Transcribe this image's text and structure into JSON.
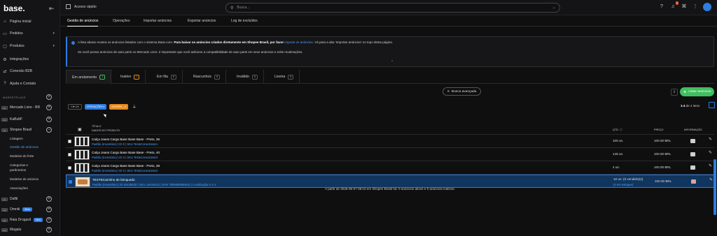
{
  "app": {
    "logo": "base."
  },
  "sidebar": {
    "items": [
      {
        "label": "Página inicial",
        "icon": "home-icon"
      },
      {
        "label": "Pedidos",
        "icon": "cart-icon"
      },
      {
        "label": "Produtos",
        "icon": "box-icon"
      },
      {
        "label": "Integrações",
        "icon": "plug-icon"
      },
      {
        "label": "Conexão B2B",
        "icon": "handshake-icon"
      },
      {
        "label": "Ajuda e Contato",
        "icon": "help-icon"
      }
    ],
    "section_label": "MARKETPLACE",
    "marketplaces": [
      {
        "label": "Mercado Livre - BR"
      },
      {
        "label": "KaBuM!"
      },
      {
        "label": "Shopee Brasil"
      }
    ],
    "shopee_sub": [
      {
        "label": "Listagem"
      },
      {
        "label": "Gestão de anúncios"
      },
      {
        "label": "Modelos de frete"
      },
      {
        "label": "Categorias e"
      },
      {
        "label": "parâmetros"
      },
      {
        "label": "Modelos de anúncio"
      },
      {
        "label": "Associações"
      }
    ],
    "more_marketplaces": [
      {
        "label": "Dafiti"
      },
      {
        "label": "Omnik",
        "tag": "Beta"
      },
      {
        "label": "Raia Drogasil",
        "tag": "New"
      },
      {
        "label": "Magalu"
      }
    ]
  },
  "topbar": {
    "quick_access": "Acesso rápido",
    "search_placeholder": "Busca...",
    "notification_count": "1"
  },
  "main_tabs": [
    {
      "label": "Gestão de anúncios"
    },
    {
      "label": "Operações"
    },
    {
      "label": "Importar anúncios"
    },
    {
      "label": "Exportar anúncios"
    },
    {
      "label": "Log de excluídos"
    }
  ],
  "info": {
    "line1_a": "A lista abaixo mostra os anúncios listados com o sistema Base.com.",
    "line1_b": "Para baixar os anúncios criados diretamente em Shopee Brasil, por favor",
    "line1_link": "importe os anúncios",
    "line1_c": ". Vá para a aba 'Importar anúncios' no topo desta página.",
    "line2": "Se você possui anúncios de auto parts no Mercado Livre, é importante que você adicione a compatibilidade de auto parts em seus anúncios e evite moderações."
  },
  "status_tabs": [
    {
      "label": "Em andamento",
      "count": "4"
    },
    {
      "label": "Inativo",
      "count": "1"
    },
    {
      "label": "Em fila",
      "count": "0"
    },
    {
      "label": "Rascunhos",
      "count": "0"
    },
    {
      "label": "Inválido",
      "count": "0"
    },
    {
      "label": "Lixeira",
      "count": "0"
    }
  ],
  "toolbar": {
    "advanced_search": "Busca avançada",
    "list_button": "Listar anúncios",
    "bulk_count": "1/4",
    "operations": "OPERAÇÕES",
    "sync": "SUSPEN...",
    "pagination_range": "1-4",
    "pagination_suffix": "de 4 itens"
  },
  "table": {
    "headers": {
      "title": "TÍTULO",
      "details": "DADOS DO PRODUTO",
      "qty": "QTD.",
      "price": "PREÇO",
      "info": "INFORMAÇÃO"
    },
    "rows": [
      {
        "name": "Calça Jeans Cargo Base Base Base - Preto, 36",
        "meta": "Padrão (Inventário) | ID 0 | SKU TesteConectaVar1",
        "qty": "100 un.",
        "qty_note": "",
        "price": "100.00 BRL"
      },
      {
        "name": "Calça Jeans Cargo Base Base Base - Preto, 40",
        "meta": "Padrão (Inventário) | ID 0 | SKU TesteConectaVar3",
        "qty": "148 un.",
        "qty_note": "",
        "price": "100.00 BRL"
      },
      {
        "name": "Calça Jeans Cargo Base Base Base - Preto, 38",
        "meta": "Padrão (Inventário) | ID 0 | SKU TesteConectaVar2",
        "qty": "4 un.",
        "qty_note": "",
        "price": "100.00 BRL"
      },
      {
        "name": "TESTECarrinho de brinquedo",
        "meta": "Padrão (Inventário) | ID 62435832 | SKU carrinho12 | EAN 7908089065510 | Localização A-1-1",
        "qty": "10 un. (0 vendido(s))",
        "qty_note": "(0 em estoque)",
        "price": "100.00 BRL"
      }
    ],
    "footer": "A partir de 2025-05-07 08:10 em Shopee Brasil há: 0 anúncios ativos e 0 anúncios inativos."
  }
}
